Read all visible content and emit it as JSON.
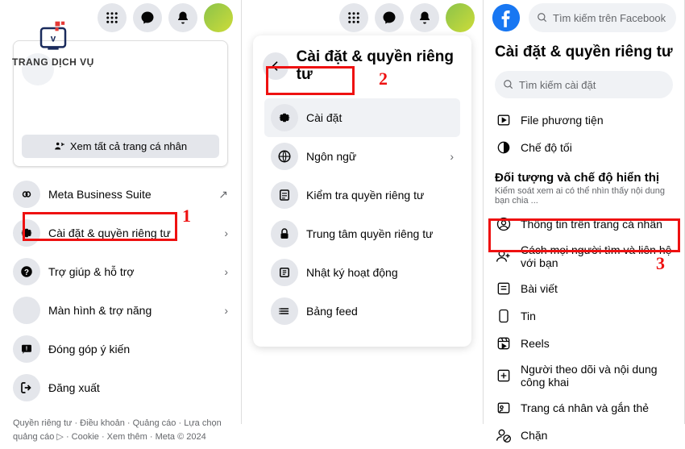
{
  "watermark_text": "TRANG DỊCH VỤ",
  "panel1": {
    "view_all": "Xem tất cả trang cá nhân",
    "menu": [
      {
        "label": "Meta Business Suite",
        "icon": "infinity",
        "trailing": "arrow-up-right"
      },
      {
        "label": "Cài đặt & quyền riêng tư",
        "icon": "gear",
        "trailing": "chevron"
      },
      {
        "label": "Trợ giúp & hỗ trợ",
        "icon": "help",
        "trailing": "chevron"
      },
      {
        "label": "Màn hình & trợ năng",
        "icon": "moon",
        "trailing": "chevron"
      },
      {
        "label": "Đóng góp ý kiến",
        "icon": "feedback",
        "trailing": ""
      },
      {
        "label": "Đăng xuất",
        "icon": "logout",
        "trailing": ""
      }
    ],
    "footer": "Quyền riêng tư · Điều khoản · Quảng cáo · Lựa chọn quảng cáo ▷ · Cookie · Xem thêm · Meta © 2024"
  },
  "panel2": {
    "title": "Cài đặt & quyền riêng tư",
    "menu": [
      {
        "label": "Cài đặt",
        "icon": "gear",
        "trailing": "",
        "selected": true
      },
      {
        "label": "Ngôn ngữ",
        "icon": "globe",
        "trailing": "chevron"
      },
      {
        "label": "Kiểm tra quyền riêng tư",
        "icon": "checklist",
        "trailing": ""
      },
      {
        "label": "Trung tâm quyền riêng tư",
        "icon": "lock",
        "trailing": ""
      },
      {
        "label": "Nhật ký hoạt động",
        "icon": "activity",
        "trailing": ""
      },
      {
        "label": "Bảng feed",
        "icon": "feed",
        "trailing": ""
      }
    ]
  },
  "panel3": {
    "search_top": "Tìm kiếm trên Facebook",
    "title": "Cài đặt & quyền riêng tư",
    "search_settings": "Tìm kiếm cài đặt",
    "general": [
      {
        "label": "File phương tiện",
        "icon": "play-box"
      },
      {
        "label": "Chế độ tối",
        "icon": "dark-mode"
      }
    ],
    "section_title": "Đối tượng và chế độ hiển thị",
    "section_sub": "Kiểm soát xem ai có thể nhìn thấy nội dung bạn chia ...",
    "audience": [
      {
        "label": "Thông tin trên trang cá nhân",
        "icon": "user-circle"
      },
      {
        "label": "Cách mọi người tìm và liên hệ với bạn",
        "icon": "user-add"
      },
      {
        "label": "Bài viết",
        "icon": "post"
      },
      {
        "label": "Tin",
        "icon": "story"
      },
      {
        "label": "Reels",
        "icon": "reels"
      },
      {
        "label": "Người theo dõi và nội dung công khai",
        "icon": "follow"
      },
      {
        "label": "Trang cá nhân và gắn thẻ",
        "icon": "tag"
      },
      {
        "label": "Chặn",
        "icon": "block"
      }
    ]
  },
  "steps": {
    "s1": "1",
    "s2": "2",
    "s3": "3"
  }
}
